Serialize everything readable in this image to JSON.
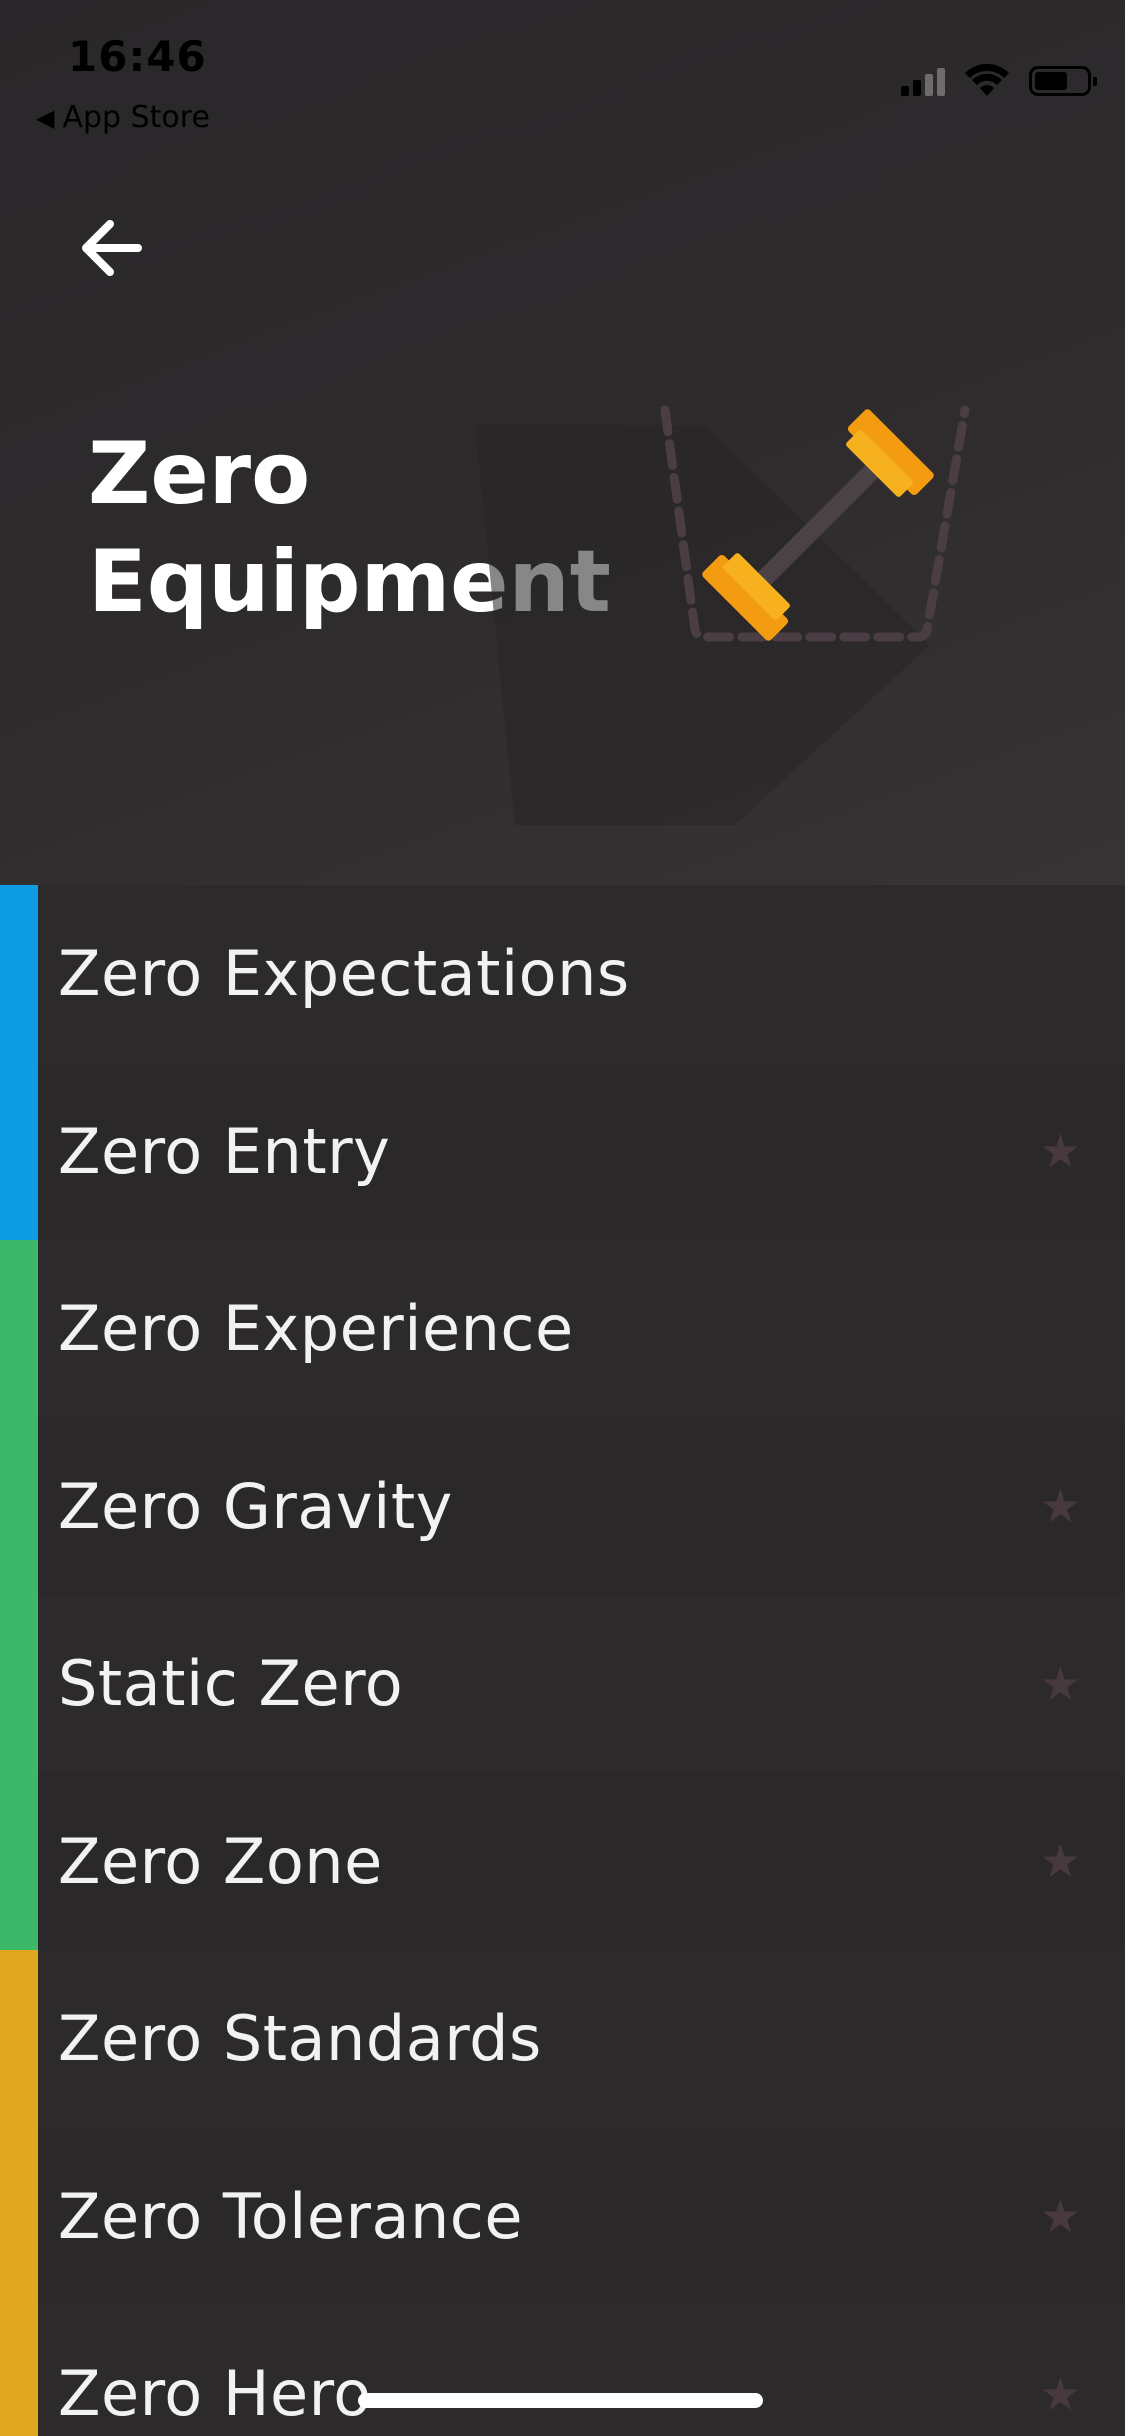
{
  "status_bar": {
    "time": "16:46",
    "back_app": "App Store",
    "back_glyph": "◀"
  },
  "header": {
    "title": "Zero\nEquipment",
    "back_icon": "arrow-left-icon",
    "illustration_icon": "dumbbell-in-basket-icon"
  },
  "colors": {
    "blue": "#0d9be2",
    "green": "#3db86b",
    "yellow": "#e0a81e",
    "star": "#47393f",
    "dumbbell": "#f4a316"
  },
  "list": {
    "star_glyph": "★",
    "items": [
      {
        "label": "Zero Expectations",
        "group_color": "#0d9be2",
        "starred": false
      },
      {
        "label": "Zero Entry",
        "group_color": "#0d9be2",
        "starred": true
      },
      {
        "label": "Zero Experience",
        "group_color": "#3db86b",
        "starred": false
      },
      {
        "label": "Zero Gravity",
        "group_color": "#3db86b",
        "starred": true
      },
      {
        "label": "Static Zero",
        "group_color": "#3db86b",
        "starred": true
      },
      {
        "label": "Zero Zone",
        "group_color": "#3db86b",
        "starred": true
      },
      {
        "label": "Zero Standards",
        "group_color": "#e0a81e",
        "starred": false
      },
      {
        "label": "Zero Tolerance",
        "group_color": "#e0a81e",
        "starred": true
      },
      {
        "label": "Zero Hero",
        "group_color": "#e0a81e",
        "starred": true
      }
    ]
  }
}
